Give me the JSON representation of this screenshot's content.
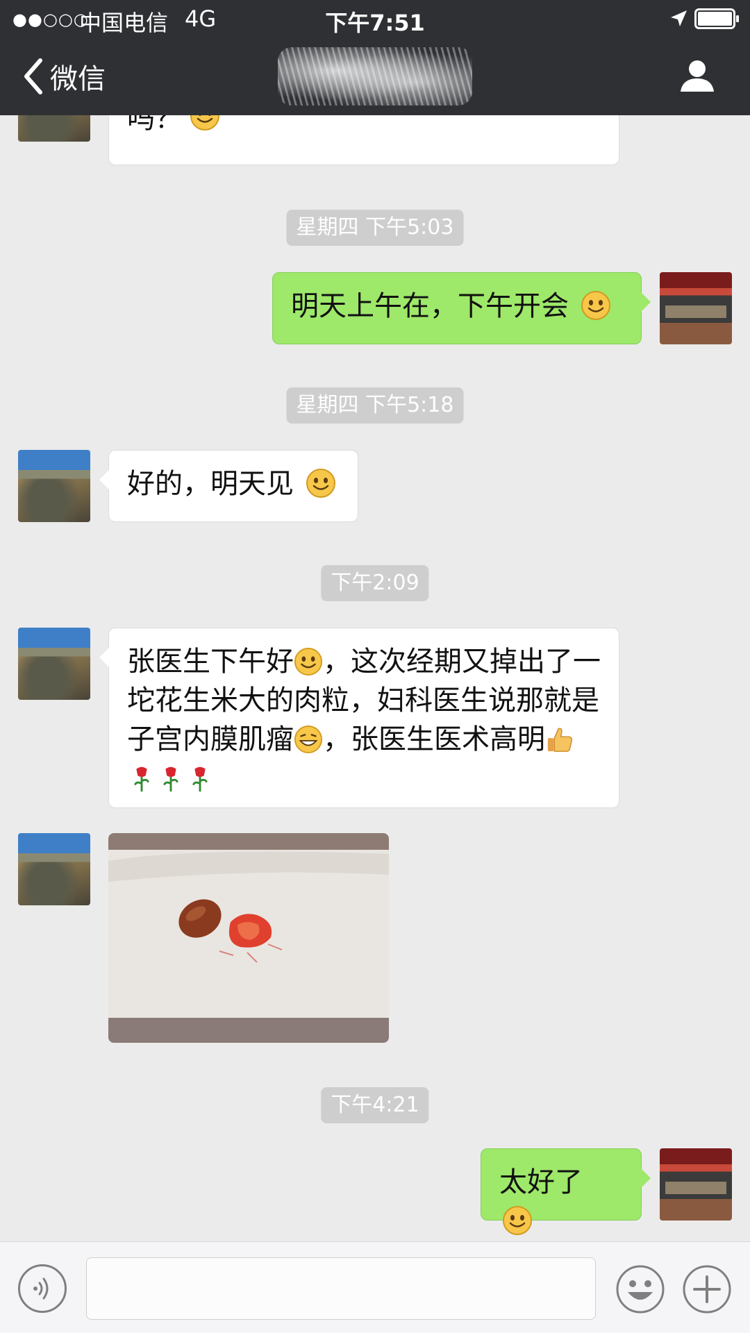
{
  "status_bar": {
    "signal": "●●○○○",
    "carrier": "中国电信",
    "network": "4G",
    "time": "下午7:51"
  },
  "nav": {
    "back_label": "微信"
  },
  "messages": {
    "partial_top": "吗？",
    "ts1": "星期四 下午5:03",
    "m1": "明天上午在，下午开会",
    "ts2": "星期四 下午5:18",
    "m2": "好的，明天见",
    "ts3": "下午2:09",
    "m3_part1": "张医生下午好",
    "m3_part2": "，这次经期又掉出了一坨花生米大的肉粒，妇科医生说那就是子宫内膜肌瘤",
    "m3_part3": "，张医生医术高明",
    "ts4": "下午4:21",
    "m4": "太好了"
  },
  "input": {
    "value": "",
    "placeholder": ""
  },
  "colors": {
    "nav_bg": "#2e3034",
    "chat_bg": "#ebebeb",
    "sent_bubble": "#9ee86a",
    "received_bubble": "#ffffff",
    "timestamp_bg": "#cecece"
  },
  "icons": {
    "back": "chevron-left-icon",
    "profile": "person-icon",
    "location": "location-arrow-icon",
    "battery": "battery-icon",
    "voice": "voice-icon",
    "emoji": "emoji-face-icon",
    "plus": "plus-icon"
  }
}
